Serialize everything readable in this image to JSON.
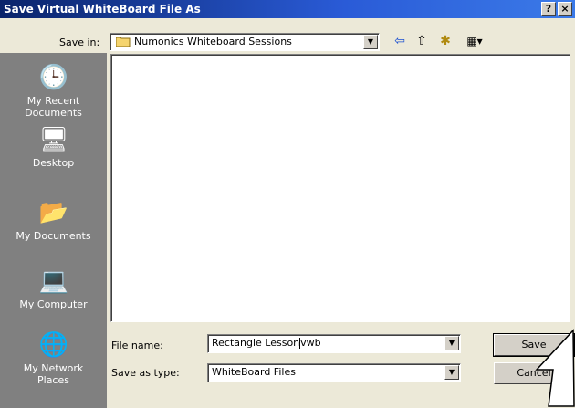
{
  "window": {
    "title": "Save Virtual WhiteBoard File As",
    "help_label": "?",
    "close_label": "×"
  },
  "save_in": {
    "label": "Save in:",
    "folder": "Numonics Whiteboard Sessions"
  },
  "toolbar": {
    "back_icon": "⇦",
    "up_icon": "⇧",
    "new_folder_icon": "✱",
    "views_icon": "▦▾"
  },
  "places": [
    {
      "label": "My Recent Documents",
      "icon": "🕒"
    },
    {
      "label": "Desktop",
      "icon": "🖥"
    },
    {
      "label": "My Documents",
      "icon": "📂"
    },
    {
      "label": "My Computer",
      "icon": "💻"
    },
    {
      "label": "My Network Places",
      "icon": "🌐"
    }
  ],
  "file_name": {
    "label": "File name:",
    "value_before_caret": "Rectangle Lesson",
    "value_after_caret": "vwb"
  },
  "save_as_type": {
    "label": "Save as type:",
    "value": "WhiteBoard Files"
  },
  "buttons": {
    "save": "Save",
    "cancel": "Cancel"
  }
}
